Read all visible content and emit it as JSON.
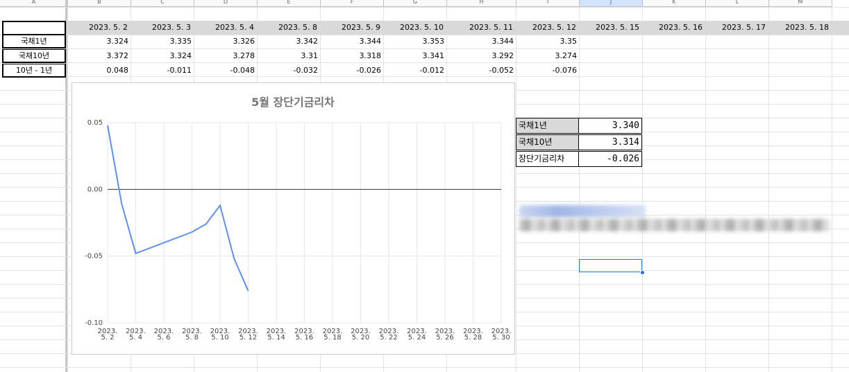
{
  "sheet": {
    "column_headers": [
      "A",
      "B",
      "C",
      "D",
      "E",
      "F",
      "G",
      "H",
      "I",
      "J",
      "K",
      "L",
      "M"
    ],
    "selected_column": "J",
    "dates": [
      "2023. 5. 2",
      "2023. 5. 3",
      "2023. 5. 4",
      "2023. 5. 8",
      "2023. 5. 9",
      "2023. 5. 10",
      "2023. 5. 11",
      "2023. 5. 12",
      "2023. 5. 15",
      "2023. 5. 16",
      "2023. 5. 17",
      "2023. 5. 18"
    ],
    "rows": [
      {
        "label": "국채1년",
        "values": [
          "3.324",
          "3.335",
          "3.326",
          "3.342",
          "3.344",
          "3.353",
          "3.344",
          "3.35"
        ]
      },
      {
        "label": "국채10년",
        "values": [
          "3.372",
          "3.324",
          "3.278",
          "3.31",
          "3.318",
          "3.341",
          "3.292",
          "3.274"
        ]
      },
      {
        "label": "10년 - 1년",
        "values": [
          "0.048",
          "-0.011",
          "-0.048",
          "-0.032",
          "-0.026",
          "-0.012",
          "-0.052",
          "-0.076"
        ]
      }
    ]
  },
  "summary": [
    {
      "label": "국채1년",
      "value": "3.340"
    },
    {
      "label": "국채10년",
      "value": "3.314"
    },
    {
      "label": "장단기금리차",
      "value": "-0.026"
    }
  ],
  "colors": {
    "line": "#5b8ff5",
    "selection": "#1a73e8",
    "header_fill": "#d9d9d9"
  },
  "chart_data": {
    "type": "line",
    "title": "5월 장단기금리차",
    "xlabel": "",
    "ylabel": "",
    "ylim": [
      -0.1,
      0.05
    ],
    "yticks": [
      "0.05",
      "0.00",
      "-0.05",
      "-0.10"
    ],
    "x_tick_labels": [
      [
        "2023.",
        "5. 2"
      ],
      [
        "2023.",
        "5. 4"
      ],
      [
        "2023.",
        "5. 6"
      ],
      [
        "2023.",
        "5. 8"
      ],
      [
        "2023.",
        "5. 10"
      ],
      [
        "2023.",
        "5. 12"
      ],
      [
        "2023.",
        "5. 14"
      ],
      [
        "2023.",
        "5. 16"
      ],
      [
        "2023.",
        "5. 18"
      ],
      [
        "2023.",
        "5. 20"
      ],
      [
        "2023.",
        "5. 22"
      ],
      [
        "2023.",
        "5. 24"
      ],
      [
        "2023.",
        "5. 26"
      ],
      [
        "2023.",
        "5. 28"
      ],
      [
        "2023.",
        "5. 30"
      ]
    ],
    "x_day_range": [
      2,
      30
    ],
    "series": [
      {
        "x": [
          "2023-05-02",
          "2023-05-03",
          "2023-05-04",
          "2023-05-08",
          "2023-05-09",
          "2023-05-10",
          "2023-05-11",
          "2023-05-12"
        ],
        "values": [
          0.048,
          -0.011,
          -0.048,
          -0.032,
          -0.026,
          -0.012,
          -0.052,
          -0.076
        ]
      }
    ],
    "grid": true
  }
}
